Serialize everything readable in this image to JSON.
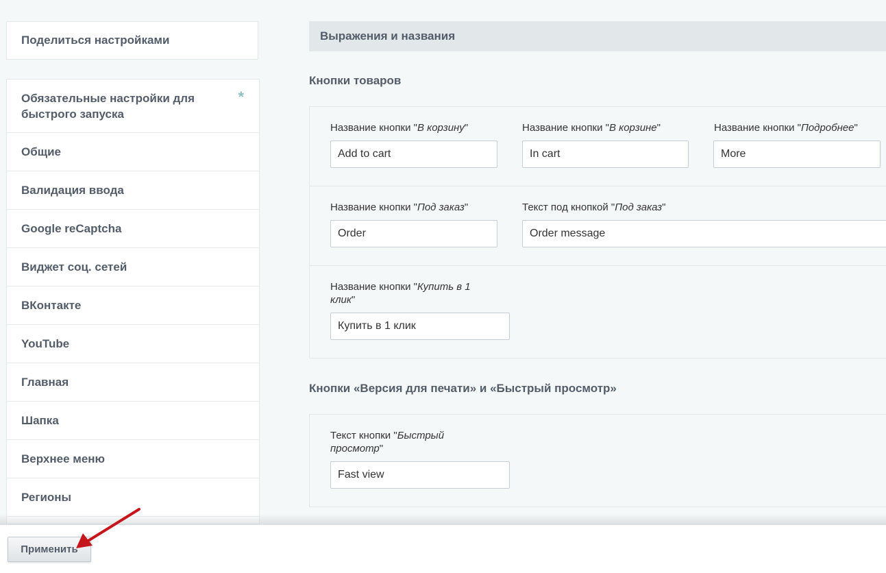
{
  "sidebar": {
    "share": "Поделиться настройками",
    "items": [
      {
        "label": "Обязательные настройки для быстрого запуска",
        "marker": "*"
      },
      {
        "label": "Общие"
      },
      {
        "label": "Валидация ввода"
      },
      {
        "label": "Google reCaptcha"
      },
      {
        "label": "Виджет соц. сетей"
      },
      {
        "label": "ВКонтакте"
      },
      {
        "label": "YouTube"
      },
      {
        "label": "Главная"
      },
      {
        "label": "Шапка"
      },
      {
        "label": "Верхнее меню"
      },
      {
        "label": "Регионы"
      }
    ]
  },
  "main": {
    "section_title": "Выражения и названия",
    "group1": {
      "title": "Кнопки товаров",
      "fields": [
        {
          "label_prefix": "Название кнопки \"",
          "label_em": "В корзину",
          "label_suffix": "\"",
          "value": "Add to cart"
        },
        {
          "label_prefix": "Название кнопки \"",
          "label_em": "В корзине",
          "label_suffix": "\"",
          "value": "In cart"
        },
        {
          "label_prefix": "Название кнопки \"",
          "label_em": "Подробнее",
          "label_suffix": "\"",
          "value": "More"
        },
        {
          "label_prefix": "Название кнопки \"",
          "label_em": "Под заказ",
          "label_suffix": "\"",
          "value": "Order"
        },
        {
          "label_prefix": "Текст под кнопкой \"",
          "label_em": "Под заказ",
          "label_suffix": "\"",
          "value": "Order message"
        },
        {
          "label_prefix": "Название кнопки \"",
          "label_em": "Купить в 1 клик",
          "label_suffix": "\"",
          "value": "Купить в 1 клик"
        }
      ]
    },
    "group2": {
      "title": "Кнопки «Версия для печати» и «Быстрый просмотр»",
      "fields": [
        {
          "label_prefix": "Текст кнопки \"",
          "label_em": "Быстрый просмотр",
          "label_suffix": "\"",
          "value": "Fast view"
        }
      ]
    }
  },
  "footer": {
    "apply_label": "Применить"
  },
  "colors": {
    "arrow": "#c4161c"
  }
}
